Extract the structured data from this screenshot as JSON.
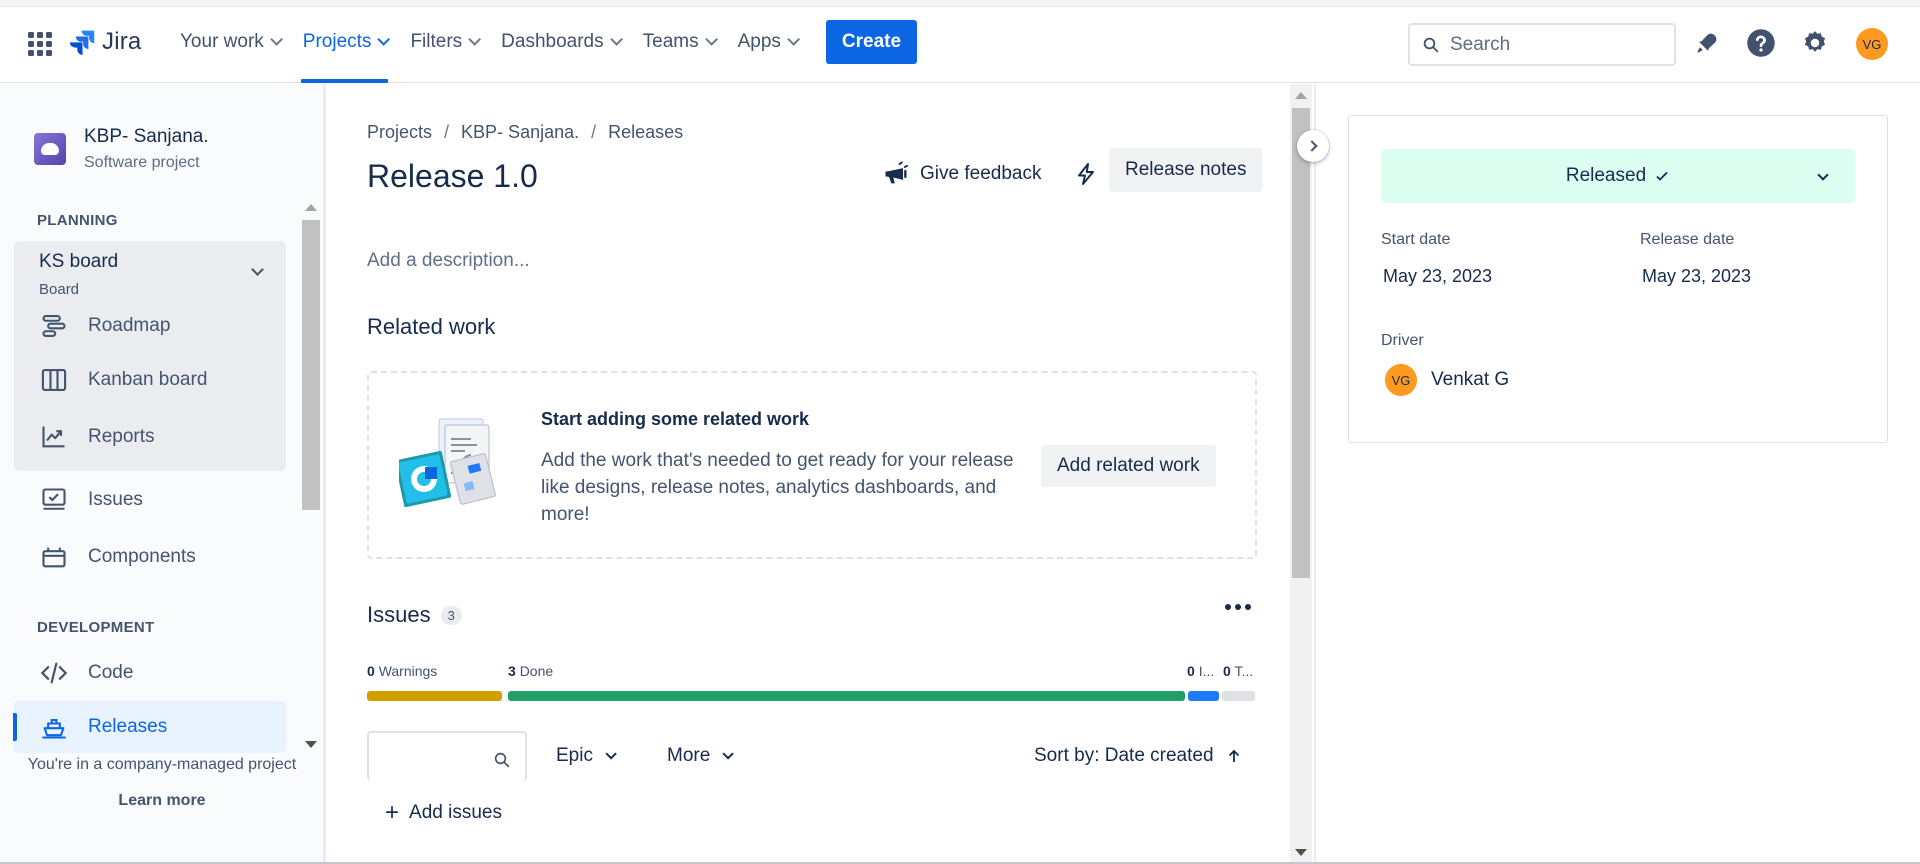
{
  "topnav": {
    "logo_text": "Jira",
    "items": [
      {
        "label": "Your work"
      },
      {
        "label": "Projects"
      },
      {
        "label": "Filters"
      },
      {
        "label": "Dashboards"
      },
      {
        "label": "Teams"
      },
      {
        "label": "Apps"
      }
    ],
    "active_item": "Projects",
    "create_label": "Create",
    "search_placeholder": "Search",
    "avatar_initials": "VG",
    "accent_color": "#0c66e4"
  },
  "sidebar": {
    "project_name": "KBP- Sanjana.",
    "project_type": "Software project",
    "planning_heading": "PLANNING",
    "board_title": "KS board",
    "board_subtitle": "Board",
    "board_items": [
      {
        "label": "Roadmap",
        "icon": "roadmap-icon"
      },
      {
        "label": "Kanban board",
        "icon": "kanban-icon"
      },
      {
        "label": "Reports",
        "icon": "reports-icon"
      }
    ],
    "items": [
      {
        "label": "Issues",
        "icon": "issues-icon"
      },
      {
        "label": "Components",
        "icon": "components-icon"
      }
    ],
    "development_heading": "DEVELOPMENT",
    "dev_items": [
      {
        "label": "Code",
        "icon": "code-icon"
      },
      {
        "label": "Releases",
        "icon": "releases-icon"
      }
    ],
    "active_item": "Releases",
    "footer_text": "You're in a company-managed project",
    "learn_more": "Learn more"
  },
  "main": {
    "breadcrumb": [
      "Projects",
      "KBP- Sanjana.",
      "Releases"
    ],
    "title": "Release 1.0",
    "give_feedback": "Give feedback",
    "release_notes": "Release notes",
    "description_placeholder": "Add a description...",
    "related_heading": "Related work",
    "related_card": {
      "heading": "Start adding some related work",
      "body": "Add the work that's needed to get ready for your release like designs, release notes, analytics dashboards, and more!",
      "button": "Add related work"
    },
    "issues": {
      "heading": "Issues",
      "count": "3",
      "progress": [
        {
          "count": "0",
          "label": "Warnings",
          "color": "#d29e00"
        },
        {
          "count": "3",
          "label": "Done",
          "color": "#22a06b"
        },
        {
          "count": "0",
          "label": "I...",
          "color": "#1d7afc"
        },
        {
          "count": "0",
          "label": "T...",
          "color": "#dfe1e6"
        }
      ],
      "filter_epic": "Epic",
      "filter_more": "More",
      "sort_label": "Sort by: Date created",
      "add_issues": "Add issues"
    }
  },
  "details": {
    "status": "Released",
    "status_color": "#dcfff1",
    "start_date_label": "Start date",
    "start_date": "May 23, 2023",
    "release_date_label": "Release date",
    "release_date": "May 23, 2023",
    "driver_label": "Driver",
    "driver_initials": "VG",
    "driver_name": "Venkat G"
  }
}
